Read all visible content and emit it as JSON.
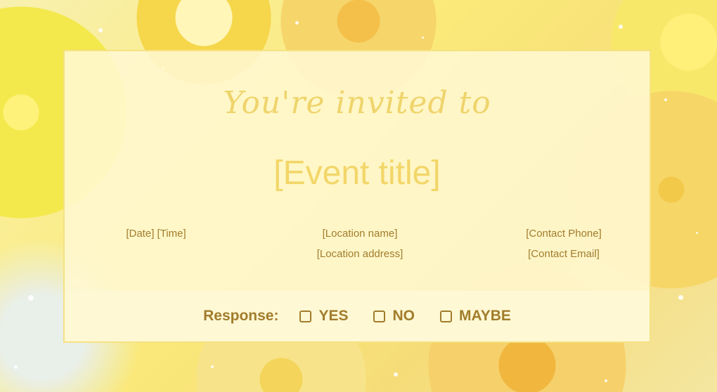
{
  "card": {
    "heading": "You're invited to",
    "event_title": "[Event title]",
    "date_time": "[Date] [Time]",
    "location_name": "[Location name]",
    "location_address": "[Location address]",
    "contact_phone": "[Contact Phone]",
    "contact_email": "[Contact Email]"
  },
  "response": {
    "label": "Response:",
    "options": [
      "YES",
      "NO",
      "MAYBE"
    ]
  },
  "colors": {
    "accent_text": "#a17c2c",
    "title_yellow": "#f2d668",
    "card_background": "#fff8d2"
  }
}
